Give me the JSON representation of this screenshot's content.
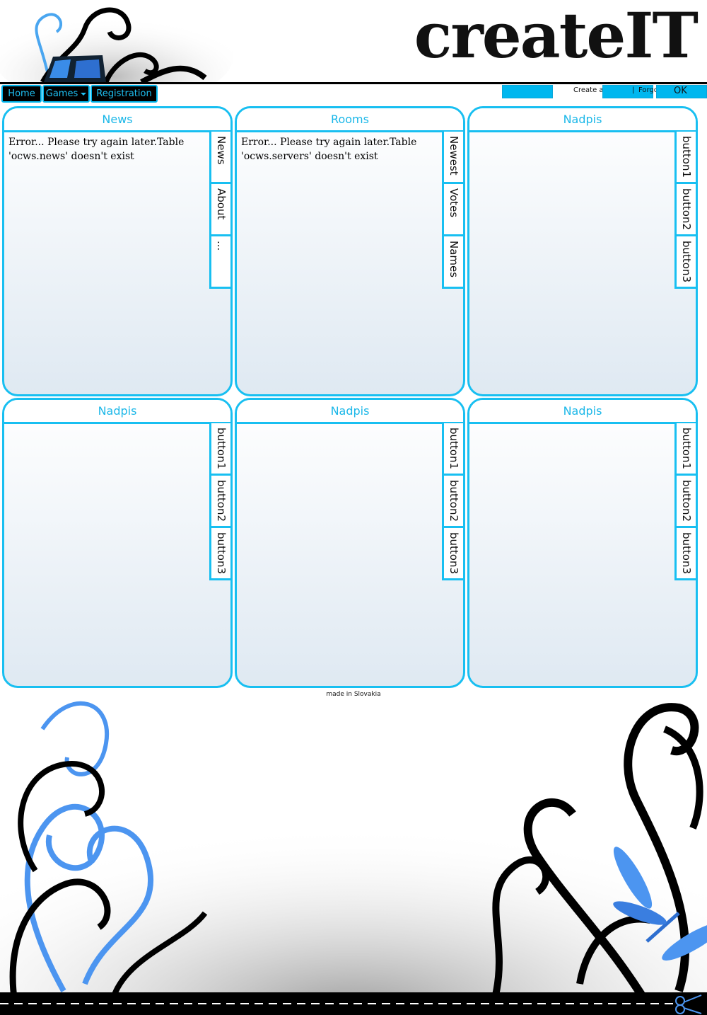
{
  "brand": {
    "logo_text": "createIT"
  },
  "nav": {
    "home": "Home",
    "games": "Games",
    "registration": "Registration"
  },
  "login": {
    "username_value": "",
    "password_value": "",
    "create_account": "Create a acount",
    "separator": "|",
    "forgotten_password": "Forgotten password?",
    "ok": "OK"
  },
  "panels": [
    {
      "title": "News",
      "content": "Error... Please try again later.Table 'ocws.news' doesn't exist",
      "tabs": [
        "News",
        "About",
        "..."
      ]
    },
    {
      "title": "Rooms",
      "content": "Error... Please try again later.Table 'ocws.servers' doesn't exist",
      "tabs": [
        "Newest",
        "Votes",
        "Names"
      ]
    },
    {
      "title": "Nadpis",
      "content": "",
      "tabs": [
        "button1",
        "button2",
        "button3"
      ]
    },
    {
      "title": "Nadpis",
      "content": "",
      "tabs": [
        "button1",
        "button2",
        "button3"
      ]
    },
    {
      "title": "Nadpis",
      "content": "",
      "tabs": [
        "button1",
        "button2",
        "button3"
      ]
    },
    {
      "title": "Nadpis",
      "content": "",
      "tabs": [
        "button1",
        "button2",
        "button3"
      ]
    }
  ],
  "footer": {
    "text": "made in Slovakia"
  },
  "colors": {
    "accent": "#18bff1",
    "nav_bg": "#000000",
    "field_bg": "#00b7ef"
  },
  "icons": [
    "swirl-decoration-icon",
    "dragonfly-icon",
    "scissors-icon",
    "dropdown-caret-icon"
  ]
}
